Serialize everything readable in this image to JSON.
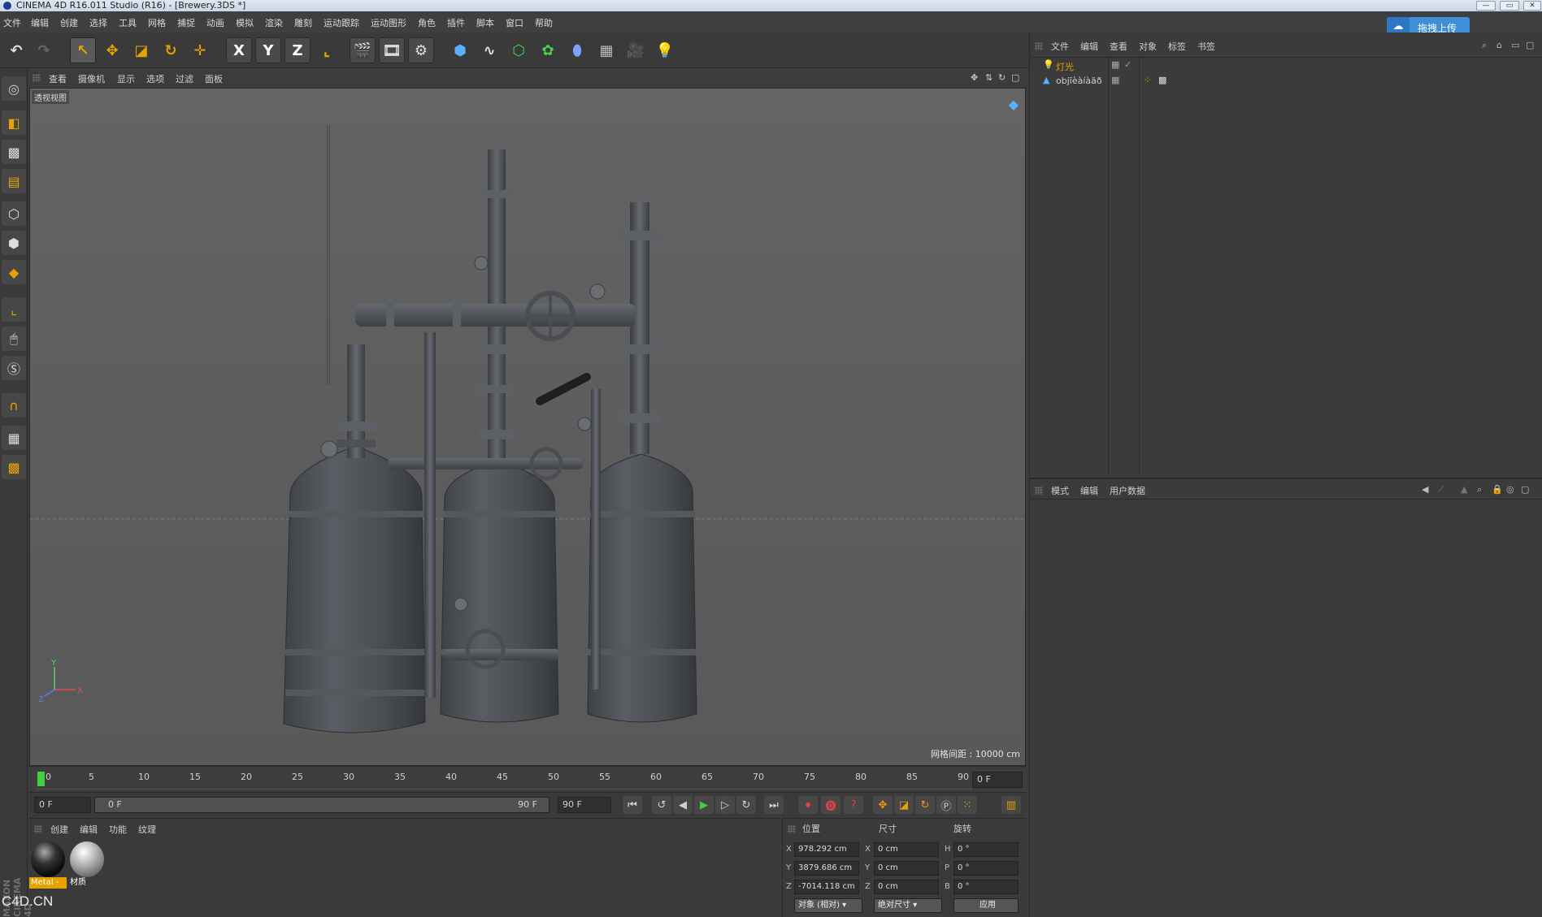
{
  "window": {
    "title": "CINEMA 4D R16.011 Studio (R16) - [Brewery.3DS *]"
  },
  "menu": [
    "文件",
    "编辑",
    "创建",
    "选择",
    "工具",
    "网格",
    "捕捉",
    "动画",
    "模拟",
    "渲染",
    "雕刻",
    "运动跟踪",
    "运动图形",
    "角色",
    "插件",
    "脚本",
    "窗口",
    "帮助"
  ],
  "upload": {
    "label": "拖拽上传"
  },
  "toolbar": {
    "axis_x": "X",
    "axis_y": "Y",
    "axis_z": "Z"
  },
  "viewport": {
    "menu": [
      "查看",
      "摄像机",
      "显示",
      "选项",
      "过滤",
      "面板"
    ],
    "label": "透视视图",
    "grid_info": "网格间距 : 10000 cm"
  },
  "timeline": {
    "ticks": [
      "0",
      "5",
      "10",
      "15",
      "20",
      "25",
      "30",
      "35",
      "40",
      "45",
      "50",
      "55",
      "60",
      "65",
      "70",
      "75",
      "80",
      "85",
      "90"
    ],
    "current_frame": "0 F"
  },
  "transport": {
    "start": "0 F",
    "range_start": "0 F",
    "range_end": "90 F",
    "end": "90 F"
  },
  "materials": {
    "menu": [
      "创建",
      "编辑",
      "功能",
      "纹理"
    ],
    "items": [
      {
        "name": "Metal -",
        "color": "#e8a100"
      },
      {
        "name": "材质",
        "color": ""
      }
    ]
  },
  "coords": {
    "headers": [
      "位置",
      "尺寸",
      "旋转"
    ],
    "pos": [
      {
        "axis": "X",
        "value": "978.292 cm"
      },
      {
        "axis": "Y",
        "value": "3879.686 cm"
      },
      {
        "axis": "Z",
        "value": "-7014.118 cm"
      }
    ],
    "size": [
      {
        "axis": "X",
        "value": "0 cm"
      },
      {
        "axis": "Y",
        "value": "0 cm"
      },
      {
        "axis": "Z",
        "value": "0 cm"
      }
    ],
    "rot": [
      {
        "axis": "H",
        "value": "0 °"
      },
      {
        "axis": "P",
        "value": "0 °"
      },
      {
        "axis": "B",
        "value": "0 °"
      }
    ],
    "mode_dropdown": "对象 (相对)",
    "size_dropdown": "绝对尺寸",
    "apply": "应用"
  },
  "objects": {
    "menu": [
      "文件",
      "编辑",
      "查看",
      "对象",
      "标签",
      "书签"
    ],
    "items": [
      {
        "name": "灯光",
        "color": "#e8a100"
      },
      {
        "name": "objïèàíàäð",
        "color": "#d0d0d0"
      }
    ]
  },
  "attributes": {
    "menu": [
      "模式",
      "编辑",
      "用户数据"
    ]
  },
  "brand": {
    "vertical": "MAXON CINEMA 4D",
    "site": "C4D.CN"
  },
  "colors": {
    "accent": "#e8a100",
    "upload": "#3e8ed8",
    "background": "#3b3b3b"
  }
}
